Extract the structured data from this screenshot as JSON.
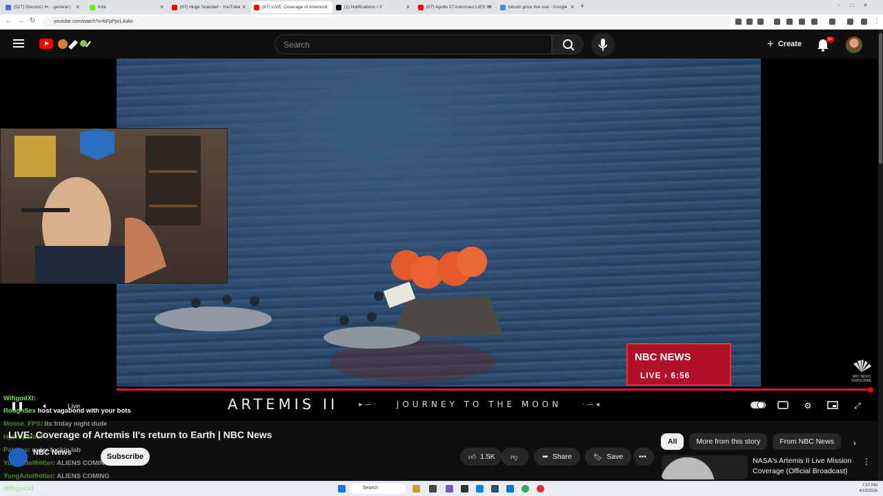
{
  "browser": {
    "tabs": [
      {
        "label": "(527) Discord | #•... general |",
        "color": "#5865f2"
      },
      {
        "label": "Kick",
        "color": "#53fc18"
      },
      {
        "label": "(67) Huge Scandal! - YouTube",
        "color": "#ff0000"
      },
      {
        "label": "(67) LIVE: Coverage of Artemis",
        "color": "#ff0000",
        "active": true
      },
      {
        "label": "(1) Notifications / X",
        "color": "#000000"
      },
      {
        "label": "(67) Apollo 17 Astronaut LIES W",
        "color": "#ff0000"
      },
      {
        "label": "bitcoin price live usd - Google",
        "color": "#4285f4"
      }
    ],
    "new_tab": "+",
    "url": "youtube.com/watch?v=bFpPpcLAiAo"
  },
  "masthead": {
    "search_placeholder": "Search",
    "create_label": "Create",
    "notification_count": "9+"
  },
  "player": {
    "nbc_title": "NBC NEWS",
    "nbc_live": "LIVE › 6:56",
    "nbc_corner": "NBC NEWS SUBSCRIBE",
    "banner_title": "ARTEMIS II",
    "banner_sub": "JOURNEY TO THE MOON",
    "live_label": "Live"
  },
  "chat": [
    {
      "user": "WifigodXI",
      "text": ":"
    },
    {
      "user": "RoughSex",
      "text": " host vagabond with your bots"
    },
    {
      "user": "Moose_FPS",
      "text": ": its friday night dude",
      "faded": true
    },
    {
      "user": "HydroponicT",
      "text": "",
      "faded": true
    },
    {
      "user": "Palaces",
      "text": ": outer fuckin lab",
      "faded": true
    },
    {
      "user": "YungAdolfHitler",
      "text": ": ALIENS COMING",
      "faded": true
    },
    {
      "user": "YungAdolfHitler",
      "text": ": ALIENS COMING",
      "faded": true
    },
    {
      "user": "WifigodXI",
      "text": ": fake",
      "faded": true
    }
  ],
  "video": {
    "title": "LIVE: Coverage of Artemis II's return to Earth | NBC News",
    "channel": "NBC News",
    "subscribe_label": "Subscribe",
    "likes": "1.5K",
    "share_label": "Share",
    "save_label": "Save"
  },
  "chips": [
    "All",
    "More from this story",
    "From NBC News"
  ],
  "recommendation": {
    "title": "NASA's Artemis II Live Mission Coverage (Official Broadcast)"
  },
  "taskbar": {
    "search_label": "Search",
    "time": "7:57 PM",
    "date": "4/10/2026"
  },
  "colors": {
    "accent": "#ff0000",
    "progress": "#e3143a",
    "chat_user": "#7ee04f",
    "nbc_red": "#b0102a"
  }
}
